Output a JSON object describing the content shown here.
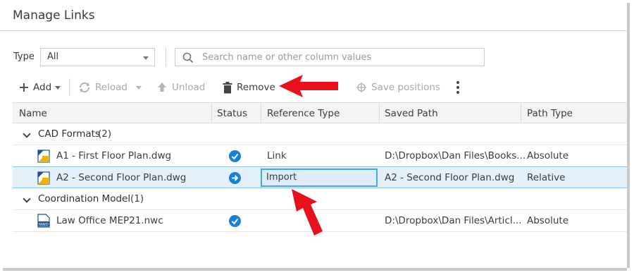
{
  "window": {
    "title": "Manage Links"
  },
  "filter": {
    "type_label": "Type",
    "type_value": "All",
    "search_placeholder": "Search name or other column values"
  },
  "toolbar": {
    "add": "Add",
    "reload": "Reload",
    "unload": "Unload",
    "remove": "Remove",
    "save_positions": "Save positions"
  },
  "table": {
    "columns": [
      "Name",
      "Status",
      "Reference Type",
      "Saved Path",
      "Path Type"
    ],
    "groups": [
      {
        "name": "CAD Formats",
        "count": "(2)",
        "rows": [
          {
            "name": "A1 - First Floor Plan.dwg",
            "status": "check-icon",
            "reference_type": "Link",
            "saved_path": "D:\\Dropbox\\Dan Files\\Books...",
            "path_type": "Absolute"
          },
          {
            "name": "A2 - Second Floor Plan.dwg",
            "status": "arrow-icon",
            "reference_type": "Import",
            "saved_path": "A2 - Second Floor Plan.dwg",
            "path_type": "Relative"
          }
        ]
      },
      {
        "name": "Coordination Model",
        "count": "(1)",
        "rows": [
          {
            "name": "Law Office MEP21.nwc",
            "status": "check-icon",
            "reference_type": "",
            "saved_path": "D:\\Dropbox\\Dan Files\\Articl...",
            "path_type": "Absolute"
          }
        ]
      }
    ]
  },
  "colors": {
    "accent": "#1a7fd6",
    "selection": "#e5f1fa",
    "annotation_arrow": "#e8111b"
  },
  "nwd_badge": "NWD"
}
